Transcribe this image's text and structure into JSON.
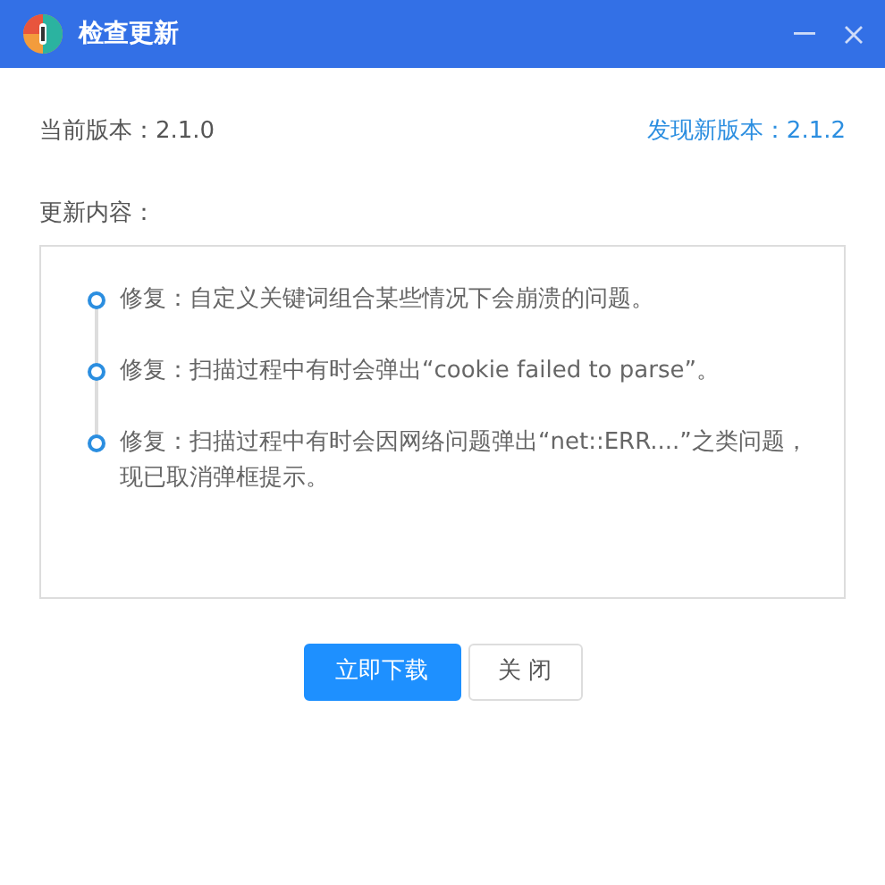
{
  "window": {
    "title": "检查更新"
  },
  "current_version": "当前版本：2.1.0",
  "new_version": "发现新版本：2.1.2",
  "changes_label": "更新内容：",
  "changes": [
    {
      "text": "修复：自定义关键词组合某些情况下会崩溃的问题。"
    },
    {
      "text": "修复：扫描过程中有时会弹出“cookie failed to parse”。"
    },
    {
      "text": "修复：扫描过程中有时会因网络问题弹出“net::ERR....”之类问题，现已取消弹框提示。"
    }
  ],
  "buttons": [
    {
      "label": "立即下载",
      "kind": "primary"
    },
    {
      "label": "关 闭",
      "kind": "secondary"
    }
  ]
}
